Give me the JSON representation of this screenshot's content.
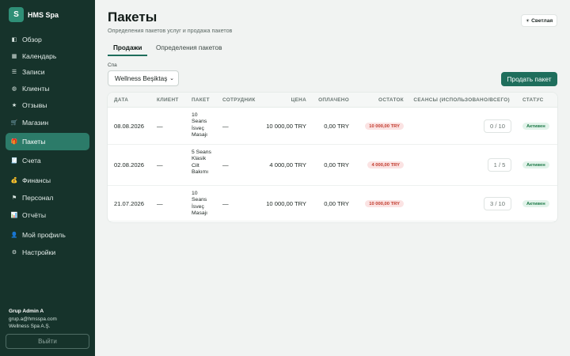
{
  "brand": {
    "initial": "S",
    "name": "HMS Spa"
  },
  "nav": [
    {
      "label": "Обзор",
      "icon": "dashboard-icon",
      "glyph": "◧"
    },
    {
      "label": "Календарь",
      "icon": "calendar-icon",
      "glyph": "▦"
    },
    {
      "label": "Записи",
      "icon": "list-icon",
      "glyph": "☰"
    },
    {
      "label": "Клиенты",
      "icon": "clients-icon",
      "glyph": "◍"
    },
    {
      "label": "Отзывы",
      "icon": "star-icon",
      "glyph": "★"
    },
    {
      "label": "Магазин",
      "icon": "shop-icon",
      "glyph": "🛒"
    },
    {
      "label": "Пакеты",
      "icon": "gift-icon",
      "glyph": "🎁",
      "active": true
    },
    {
      "label": "Счета",
      "icon": "receipt-icon",
      "glyph": "🧾"
    },
    {
      "label": "Финансы",
      "icon": "money-bag-icon",
      "glyph": "💰"
    },
    {
      "label": "Персонал",
      "icon": "staff-icon",
      "glyph": "⚑"
    },
    {
      "label": "Отчёты",
      "icon": "chart-icon",
      "glyph": "📊"
    },
    {
      "label": "Мой профиль",
      "icon": "profile-icon",
      "glyph": "👤"
    },
    {
      "label": "Настройки",
      "icon": "gear-icon",
      "glyph": "⚙"
    }
  ],
  "user": {
    "name": "Grup Admin A",
    "email": "grup.a@hmsspa.com",
    "company": "Wellness Spa A.Ş.",
    "logout_label": "Выйти"
  },
  "header": {
    "title": "Пакеты",
    "subtitle": "Определения пакетов услуг и продажа пакетов",
    "theme_label": "Светлая"
  },
  "tabs": [
    {
      "label": "Продажи",
      "active": true
    },
    {
      "label": "Определения пакетов",
      "active": false
    }
  ],
  "filter": {
    "label": "Спа",
    "value": "Wellness Beşiktaş"
  },
  "sell_button": "Продать пакет",
  "table": {
    "columns": {
      "date": "ДАТА",
      "client": "КЛИЕНТ",
      "package": "ПАКЕТ",
      "staff": "СОТРУДНИК",
      "price": "ЦЕНА",
      "paid": "ОПЛАЧЕНО",
      "balance": "ОСТАТОК",
      "sessions": "СЕАНСЫ (ИСПОЛЬЗОВАНО/ВСЕГО)",
      "status": "СТАТУС"
    },
    "rows": [
      {
        "date": "08.08.2026",
        "client": "—",
        "package": "10 Seans İsveç Masajı",
        "staff": "—",
        "price": "10 000,00 TRY",
        "paid": "0,00 TRY",
        "balance": "10 000,00 TRY",
        "sessions": "0 / 10",
        "status": "Активен"
      },
      {
        "date": "02.08.2026",
        "client": "—",
        "package": "5 Seans Klasik Cilt Bakımı",
        "staff": "—",
        "price": "4 000,00 TRY",
        "paid": "0,00 TRY",
        "balance": "4 000,00 TRY",
        "sessions": "1 / 5",
        "status": "Активен"
      },
      {
        "date": "21.07.2026",
        "client": "—",
        "package": "10 Seans İsveç Masajı",
        "staff": "—",
        "price": "10 000,00 TRY",
        "paid": "0,00 TRY",
        "balance": "10 000,00 TRY",
        "sessions": "3 / 10",
        "status": "Активен"
      }
    ]
  },
  "colors": {
    "sidebar": "#16332b",
    "accent": "#1f6e5c",
    "active_nav": "#2c7b69",
    "debt": "#c0392b",
    "status_active": "#1e7a48"
  }
}
